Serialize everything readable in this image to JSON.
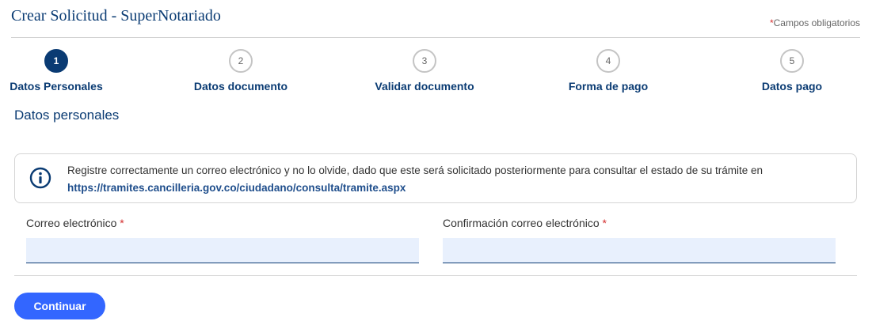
{
  "header": {
    "title": "Crear Solicitud - SuperNotariado",
    "required_star": "*",
    "required_note": "Campos obligatorios"
  },
  "stepper": {
    "steps": [
      {
        "number": "1",
        "label": "Datos Personales",
        "active": true
      },
      {
        "number": "2",
        "label": "Datos documento",
        "active": false
      },
      {
        "number": "3",
        "label": "Validar documento",
        "active": false
      },
      {
        "number": "4",
        "label": "Forma de pago",
        "active": false
      },
      {
        "number": "5",
        "label": "Datos pago",
        "active": false
      }
    ]
  },
  "section": {
    "title": "Datos personales"
  },
  "info": {
    "icon": "info-icon",
    "text": "Registre correctamente un correo electrónico y no lo olvide, dado que este será solicitado posteriormente para consultar el estado de su trámite en ",
    "link": "https://tramites.cancilleria.gov.co/ciudadano/consulta/tramite.aspx"
  },
  "form": {
    "email_label": "Correo electrónico",
    "email_required": "*",
    "email_value": "",
    "confirm_label": "Confirmación correo electrónico",
    "confirm_required": "*",
    "confirm_value": ""
  },
  "actions": {
    "continue_label": "Continuar"
  },
  "colors": {
    "primary": "#0a3b73",
    "button": "#3366ff",
    "input_bg": "#e8f0fd",
    "required": "#d32f2f"
  }
}
